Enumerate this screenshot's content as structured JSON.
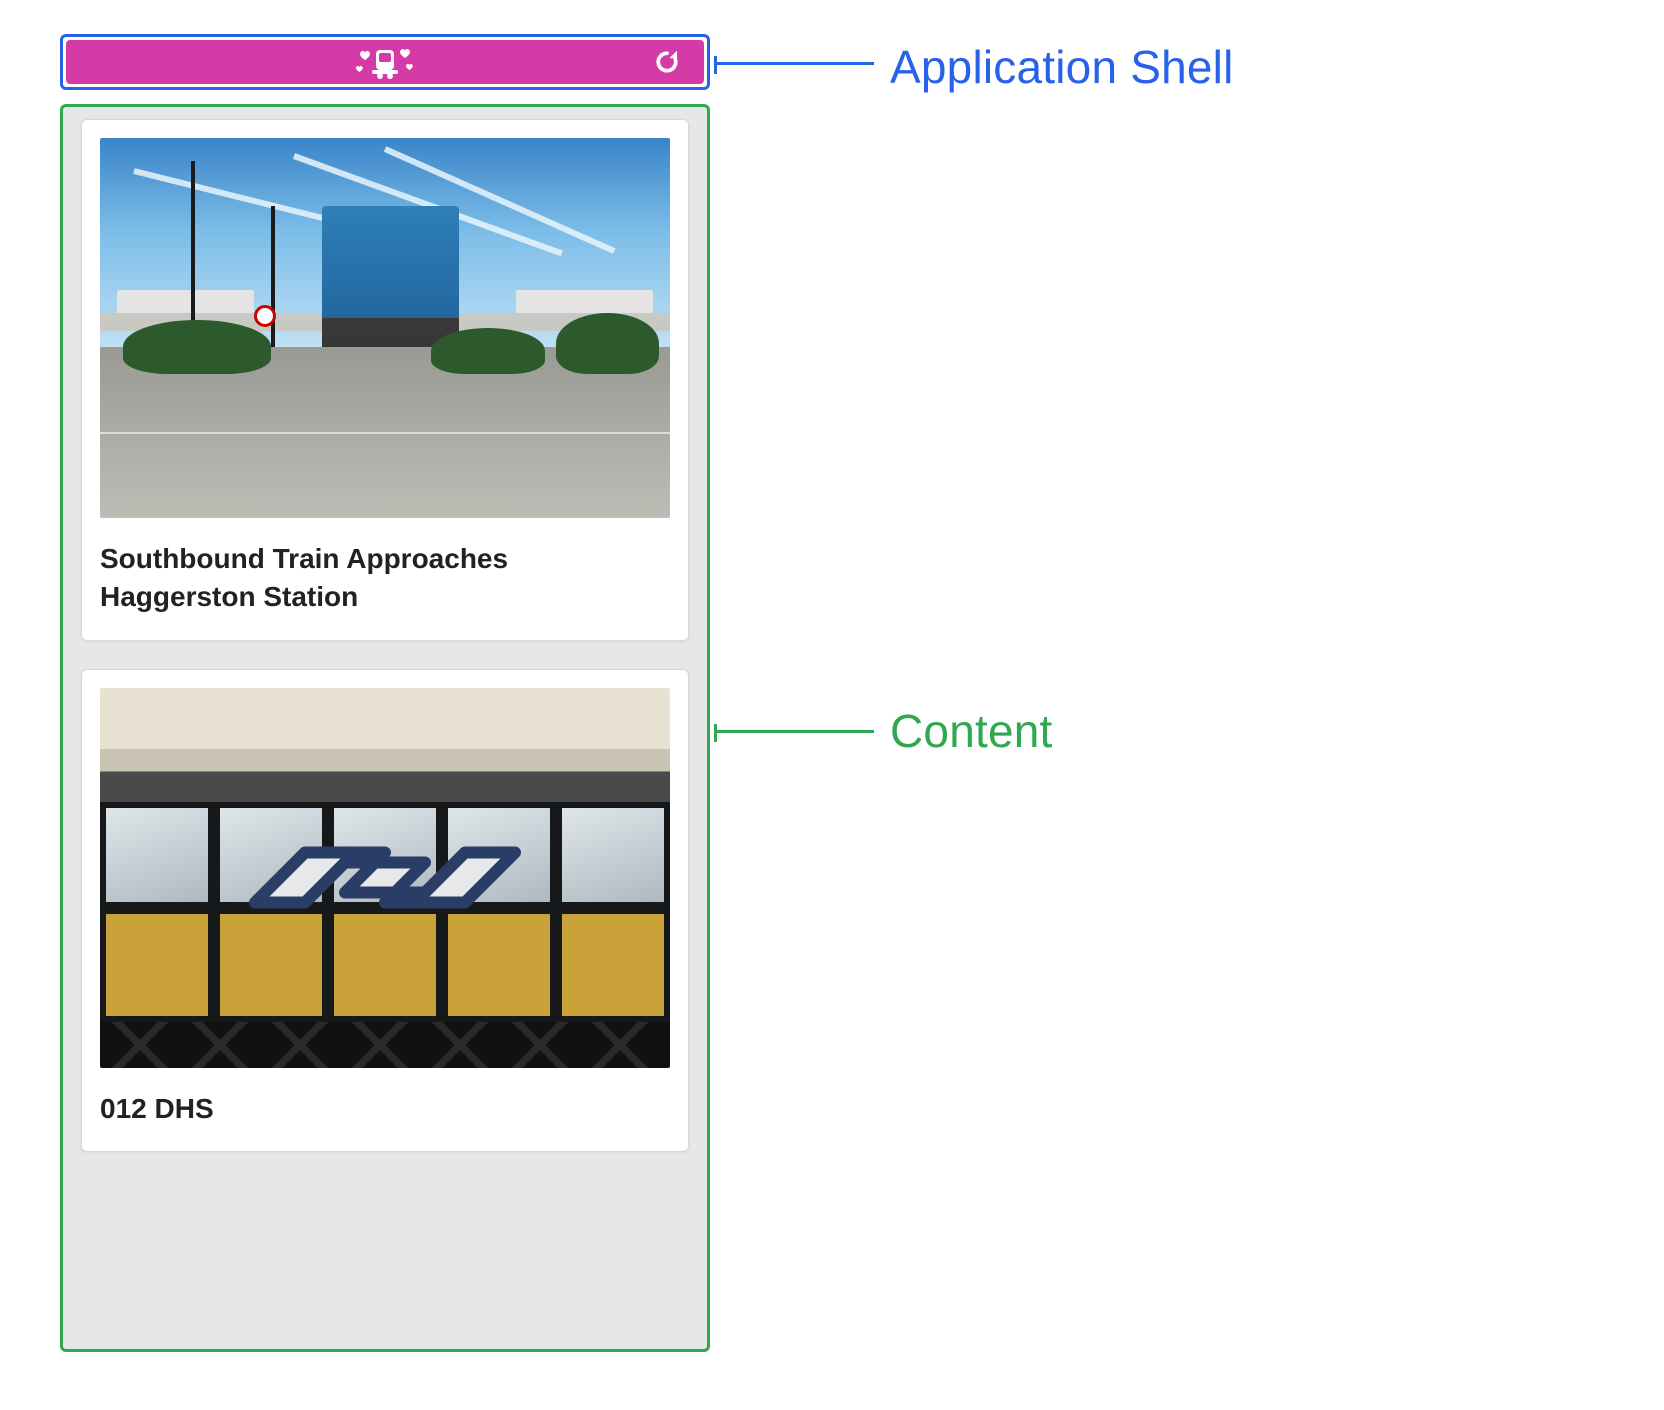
{
  "annotations": {
    "shell_label": "Application Shell",
    "content_label": "Content"
  },
  "shell": {
    "logo_name": "train-hearts-logo",
    "refresh_name": "refresh-icon",
    "accent": "#d43ba6"
  },
  "content": {
    "cards": [
      {
        "title": "Southbound Train Approaches Haggerston Station"
      },
      {
        "title": "012 DHS"
      }
    ]
  },
  "colors": {
    "shell_border": "#2862e9",
    "content_border": "#2fa84f"
  }
}
